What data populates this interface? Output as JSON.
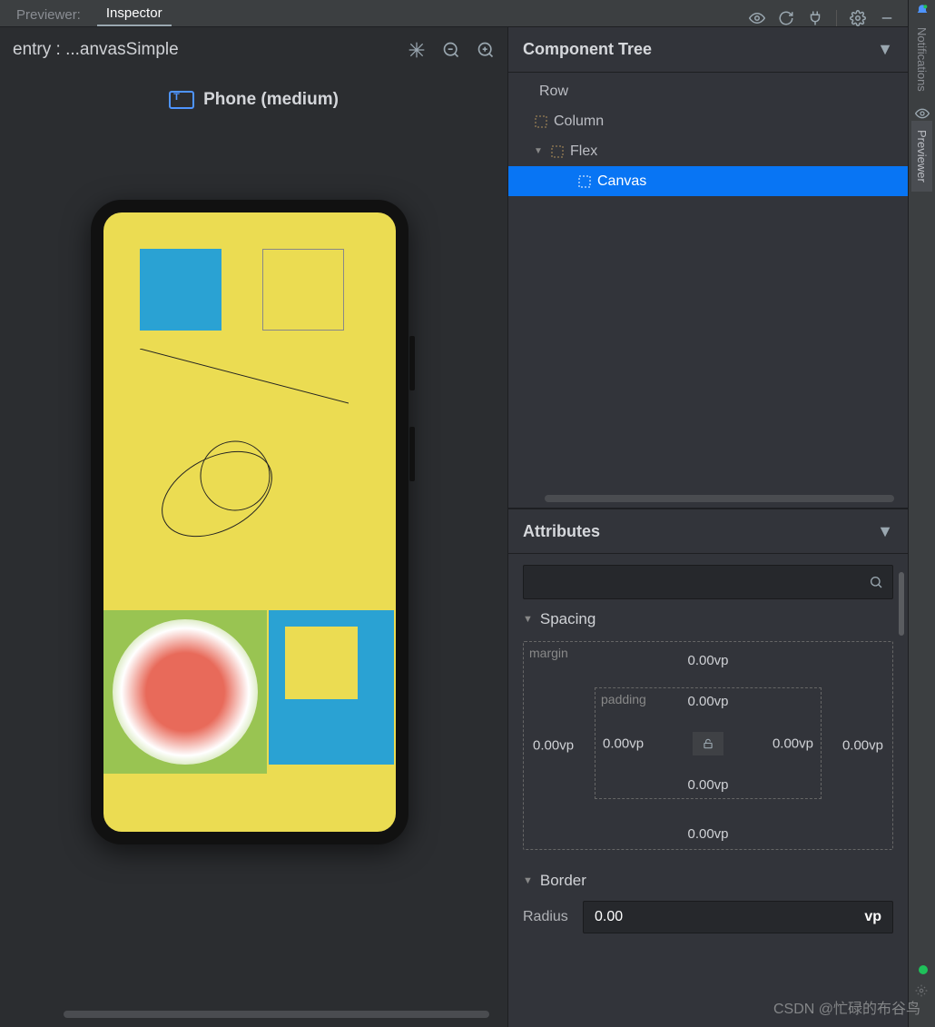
{
  "tabs": {
    "previewer": "Previewer:",
    "inspector": "Inspector"
  },
  "toolbar_icons": [
    "eye-icon",
    "refresh-icon",
    "plug-icon",
    "gear-icon",
    "minimize-icon"
  ],
  "preview": {
    "title": "entry : ...anvasSimple",
    "device_label": "Phone (medium)"
  },
  "component_tree": {
    "title": "Component Tree",
    "nodes": [
      {
        "label": "Row",
        "depth": 0,
        "expandable": false,
        "selected": false
      },
      {
        "label": "Column",
        "depth": 1,
        "expandable": false,
        "selected": false
      },
      {
        "label": "Flex",
        "depth": 1,
        "expandable": true,
        "expanded": true,
        "selected": false
      },
      {
        "label": "Canvas",
        "depth": 2,
        "expandable": false,
        "selected": true
      }
    ]
  },
  "attributes": {
    "title": "Attributes",
    "search_placeholder": "",
    "sections": {
      "spacing": {
        "title": "Spacing",
        "margin_label": "margin",
        "padding_label": "padding",
        "margin": {
          "top": "0.00vp",
          "right": "0.00vp",
          "bottom": "0.00vp",
          "left": "0.00vp"
        },
        "padding": {
          "top": "0.00vp",
          "right": "0.00vp",
          "bottom": "0.00vp",
          "left": "0.00vp"
        }
      },
      "border": {
        "title": "Border",
        "radius_label": "Radius",
        "radius_value": "0.00",
        "radius_unit": "vp"
      }
    }
  },
  "side_tabs": {
    "notifications": "Notifications",
    "previewer": "Previewer"
  },
  "watermark": "CSDN @忙碌的布谷鸟"
}
